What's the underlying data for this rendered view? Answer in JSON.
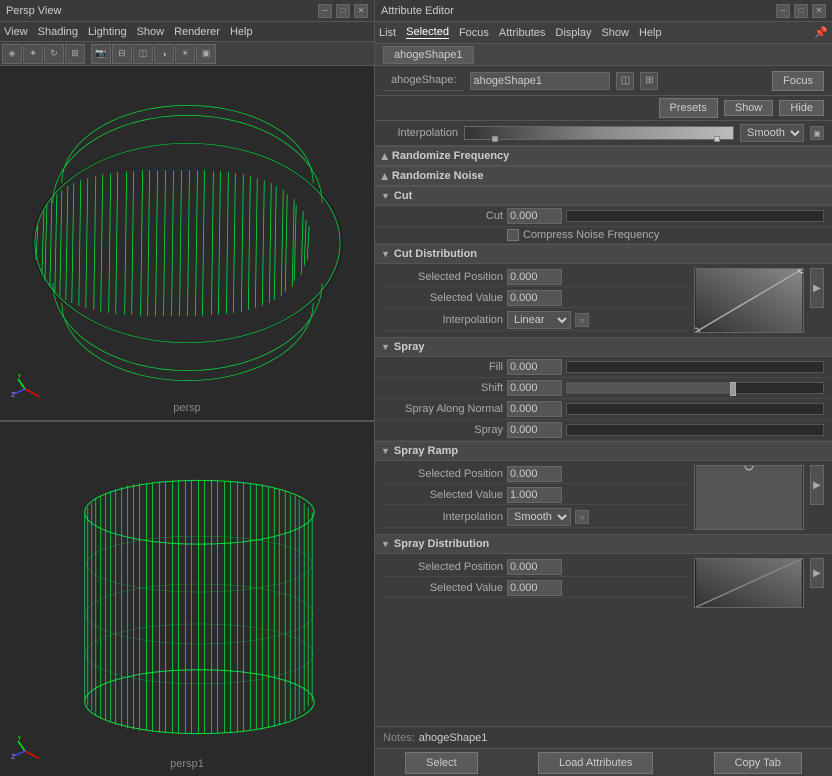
{
  "viewport": {
    "title": "Persp View",
    "top_label": "persp",
    "bottom_label": "persp1",
    "menu": [
      "View",
      "Shading",
      "Lighting",
      "Show",
      "Renderer",
      "Help"
    ]
  },
  "attr_editor": {
    "title": "Attribute Editor",
    "menu": [
      "List",
      "Selected",
      "Focus",
      "Attributes",
      "Display",
      "Show",
      "Help"
    ],
    "tab": "ahogeShape1",
    "shape_label": "ahogeShape:",
    "shape_value": "ahogeShape1",
    "focus_btn": "Focus",
    "presets_btn": "Presets",
    "show_btn": "Show",
    "hide_btn": "Hide",
    "interpolation_label": "Interpolation",
    "interpolation_value": "Smooth",
    "sections": {
      "randomize_frequency": {
        "label": "Randomize Frequency",
        "collapsed": true
      },
      "randomize_noise": {
        "label": "Randomize Noise",
        "collapsed": true
      },
      "cut": {
        "label": "Cut",
        "collapsed": false,
        "fields": [
          {
            "label": "Cut",
            "value": "0.000",
            "slider_pct": 0
          },
          {
            "checkbox": "Compress Noise Frequency"
          }
        ]
      },
      "cut_distribution": {
        "label": "Cut Distribution",
        "collapsed": false,
        "fields": [
          {
            "label": "Selected Position",
            "value": "0.000"
          },
          {
            "label": "Selected Value",
            "value": "0.000"
          },
          {
            "label": "Interpolation",
            "value": "Linear"
          }
        ]
      },
      "spray": {
        "label": "Spray",
        "collapsed": false,
        "fields": [
          {
            "label": "Fill",
            "value": "0.000",
            "slider_pct": 0
          },
          {
            "label": "Shift",
            "value": "0.000",
            "slider_pct": 65
          },
          {
            "label": "Spray Along Normal",
            "value": "0.000",
            "slider_pct": 0
          },
          {
            "label": "Spray",
            "value": "0.000",
            "slider_pct": 0
          }
        ]
      },
      "spray_ramp": {
        "label": "Spray Ramp",
        "collapsed": false,
        "fields": [
          {
            "label": "Selected Position",
            "value": "0.000"
          },
          {
            "label": "Selected Value",
            "value": "1.000"
          },
          {
            "label": "Interpolation",
            "value": "Smooth"
          }
        ]
      },
      "spray_distribution": {
        "label": "Spray Distribution",
        "collapsed": false,
        "fields": [
          {
            "label": "Selected Position",
            "value": "0.000"
          },
          {
            "label": "Selected Value",
            "value": "0.000"
          }
        ]
      }
    },
    "notes_label": "Notes:",
    "notes_value": "ahogeShape1",
    "bottom_btns": [
      "Select",
      "Load Attributes",
      "Copy Tab"
    ]
  }
}
